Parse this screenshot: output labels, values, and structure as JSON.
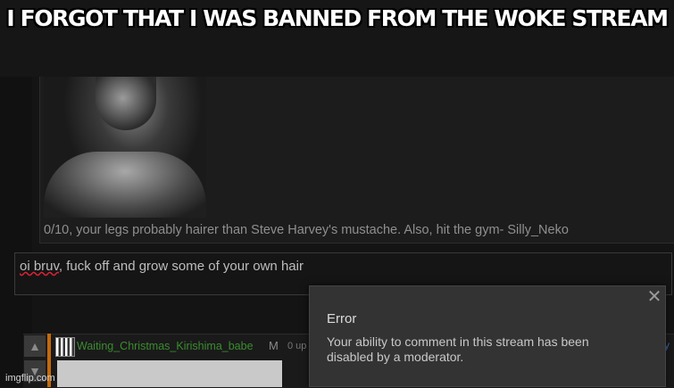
{
  "caption": "I FORGOT THAT I WAS BANNED FROM THE WOKE STREAM",
  "comment": {
    "text": "0/10, your legs probably hairer than Steve Harvey's mustache. Also, hit the gym- Silly_Neko"
  },
  "reply_input": {
    "misspelled_word": "oi bruv",
    "rest": ", fuck off and grow some of your own hair"
  },
  "list_item": {
    "username": "Waiting_Christmas_Kirishima_babe",
    "badge": "M",
    "points": "0 up",
    "vote_up_icon": "arrow-up-icon",
    "vote_down_icon": "arrow-down-icon",
    "right_link": "y"
  },
  "error_dialog": {
    "title": "Error",
    "message": "Your ability to comment in this stream has been disabled by a moderator.",
    "close_icon": "close-icon"
  },
  "watermark": "imgflip.com"
}
